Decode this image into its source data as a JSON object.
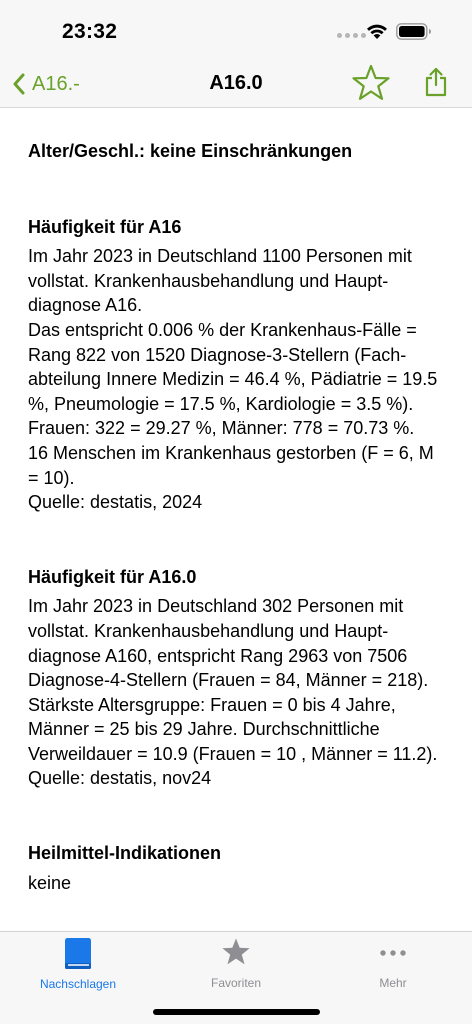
{
  "status_bar": {
    "time": "23:32"
  },
  "nav": {
    "back_label": "A16.-",
    "title": "A16.0",
    "accent_color": "#6aa12a"
  },
  "content": {
    "alter": "Alter/Geschl.: keine Einschränkungen",
    "sections": [
      {
        "heading": "Häufigkeit für A16",
        "lines": [
          "Im Jahr 2023 in Deutschland  1100 Personen mit vollstat. Krankenhausbehandlung und Haupt-diagnose A16.",
          "Das entspricht 0.006 % der Krankenhaus-Fälle = Rang 822 von 1520 Diagnose-3-Stellern (Fach-abteilung Innere Medizin = 46.4 %, Pädiatrie = 19.5 %, Pneumologie = 17.5 %, Kardiologie = 3.5 %). Frauen: 322 = 29.27 %, Männer: 778 = 70.73 %.",
          "16 Menschen im Krankenhaus gestorben (F = 6, M = 10).",
          "Quelle: destatis, 2024"
        ]
      },
      {
        "heading": "Häufigkeit für A16.0",
        "lines": [
          "Im Jahr 2023 in Deutschland  302 Personen mit vollstat. Krankenhausbehandlung und Haupt-diagnose A160, entspricht Rang 2963 von 7506 Diagnose-4-Stellern (Frauen = 84, Männer = 218).",
          "Stärkste Altersgruppe: Frauen = 0 bis 4 Jahre, Männer = 25 bis 29 Jahre.  Durchschnittliche Verweildauer = 10.9 (Frauen = 10 , Männer = 11.2).",
          "Quelle: destatis, nov24"
        ]
      },
      {
        "heading": "Heilmittel-Indikationen",
        "lines": [
          "keine"
        ]
      }
    ]
  },
  "tabs": [
    {
      "label": "Nachschlagen",
      "icon": "book-icon",
      "active": true
    },
    {
      "label": "Favoriten",
      "icon": "star-icon",
      "active": false
    },
    {
      "label": "Mehr",
      "icon": "ellipsis-icon",
      "active": false
    }
  ],
  "colors": {
    "tab_active": "#1a78e8",
    "tab_inactive": "#8e8e93",
    "accent": "#6aa12a"
  }
}
